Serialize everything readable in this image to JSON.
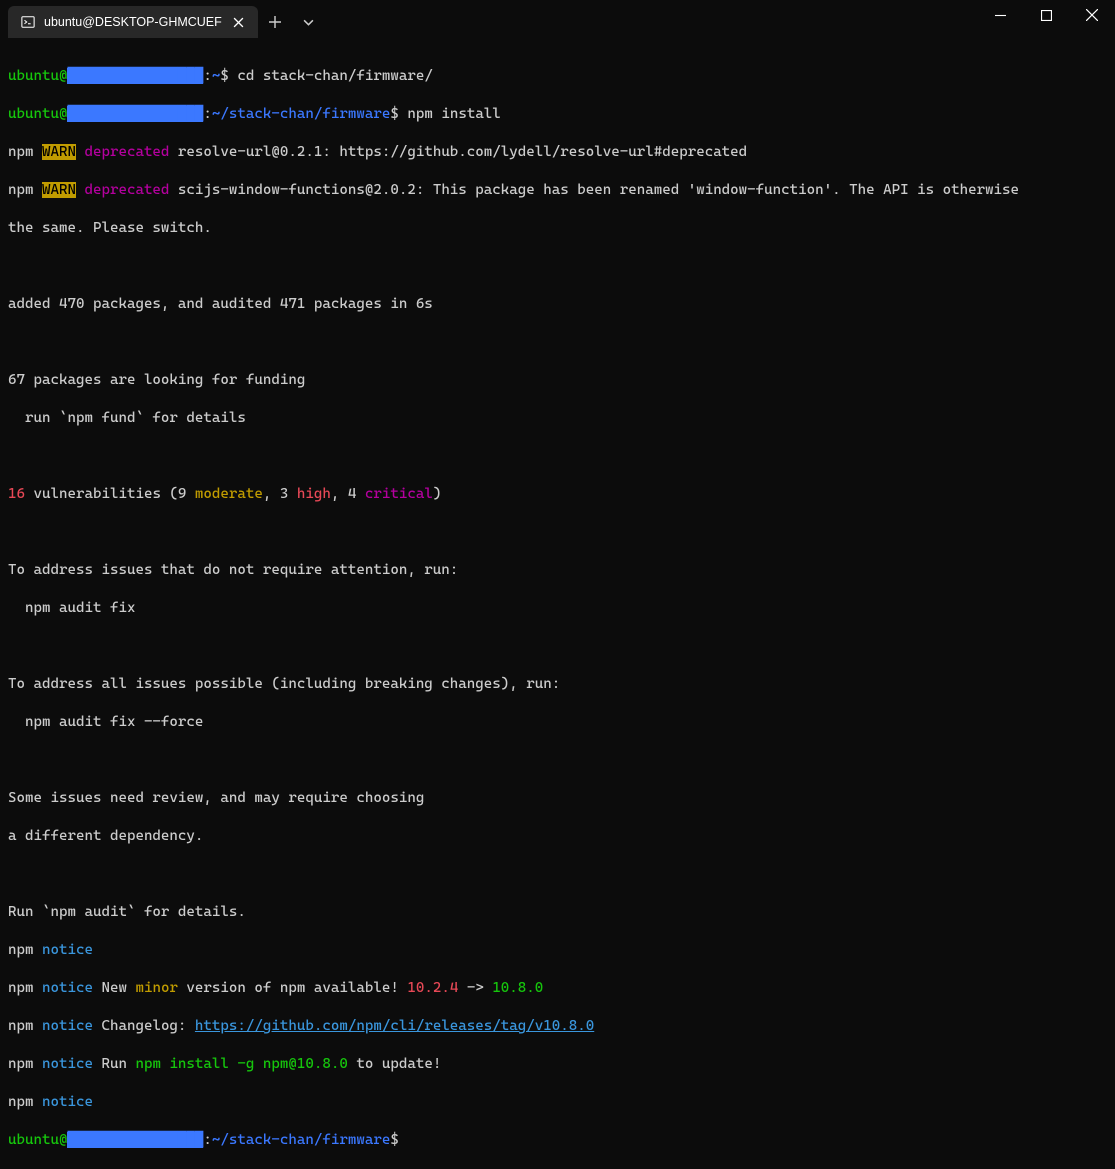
{
  "tab": {
    "title": "ubuntu@DESKTOP-GHMCUEF"
  },
  "prompt": {
    "user": "ubuntu@",
    "hostmask": "████████████████",
    "path_home": "~",
    "path_fw": "~/stack-chan/firmware",
    "dollar": "$"
  },
  "cmd1": "cd stack-chan/firmware/",
  "cmd2": "npm install",
  "l3": {
    "npm": "npm ",
    "warn": "WARN",
    "dep": " deprecated",
    "rest": " resolve-url@0.2.1: https://github.com/lydell/resolve-url#deprecated"
  },
  "l4": {
    "npm": "npm ",
    "warn": "WARN",
    "dep": " deprecated",
    "rest": " scijs-window-functions@2.0.2: This package has been renamed 'window-function'. The API is otherwise "
  },
  "l5": "the same. Please switch.",
  "l7": "added 470 packages, and audited 471 packages in 6s",
  "l9": "67 packages are looking for funding",
  "l10": "  run `npm fund` for details",
  "l12": {
    "count": "16",
    "a": " vulnerabilities (9 ",
    "mod": "moderate",
    "b": ", 3 ",
    "high": "high",
    "c": ", 4 ",
    "crit": "critical",
    "d": ")"
  },
  "l14": "To address issues that do not require attention, run:",
  "l15": "  npm audit fix",
  "l17": "To address all issues possible (including breaking changes), run:",
  "l18": "  npm audit fix --force",
  "l20": "Some issues need review, and may require choosing",
  "l21": "a different dependency.",
  "l23": "Run `npm audit` for details.",
  "notice": {
    "npm": "npm ",
    "word": "notice",
    "new_a": " New ",
    "minor": "minor",
    "new_b": " version of npm available! ",
    "old_v": "10.2.4",
    "arrow": " -> ",
    "new_v": "10.8.0",
    "chlog_a": " Changelog: ",
    "chlog_url": "https://github.com/npm/cli/releases/tag/v10.8.0",
    "run_a": " Run ",
    "run_cmd": "npm install -g npm@10.8.0",
    "run_b": " to update!"
  }
}
